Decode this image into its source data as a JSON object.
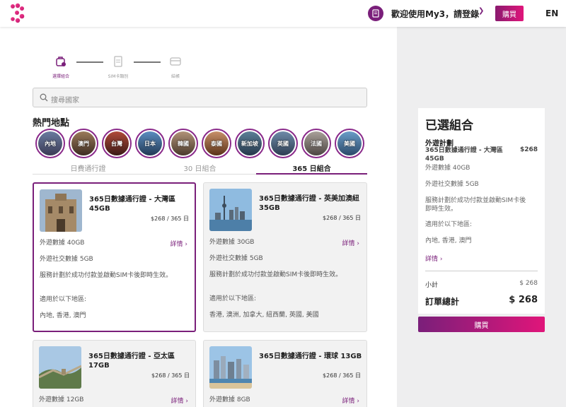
{
  "header": {
    "welcome": "歡迎使用My3，請登錄",
    "buy_label": "購買",
    "lang_label": "EN"
  },
  "stepper": [
    {
      "label": "選擇組合",
      "state": "active"
    },
    {
      "label": "SIM卡類別",
      "state": "inactive"
    },
    {
      "label": "結帳",
      "state": "inactive"
    }
  ],
  "search": {
    "placeholder": "搜尋國家"
  },
  "hot": {
    "title": "熱門地點",
    "destinations": [
      "內地",
      "澳門",
      "台灣",
      "日本",
      "韓國",
      "泰國",
      "新加坡",
      "英國",
      "法國",
      "美國"
    ]
  },
  "tabs": [
    {
      "label": "日費通行證",
      "active": false
    },
    {
      "label": "30 日組合",
      "active": false
    },
    {
      "label": "365 日組合",
      "active": true
    }
  ],
  "cards": [
    {
      "title": "365日數據通行證 - 大灣區 45GB",
      "price": "$268 / 365 日",
      "local_data": "外遊數據 40GB",
      "social_data": "外遊社交數據 5GB",
      "desc": "服務計劃於成功付款並啟動SIM卡後即時生效。",
      "regions_label": "適用於以下地區:",
      "regions": "內地, 香港, 澳門",
      "detail": "詳情",
      "selected": true
    },
    {
      "title": "365日數據通行證 - 英美加澳紐 35GB",
      "price": "$268 / 365 日",
      "local_data": "外遊數據 30GB",
      "social_data": "外遊社交數據 5GB",
      "desc": "服務計劃於成功付款並啟動SIM卡後即時生效。",
      "regions_label": "適用於以下地區:",
      "regions": "香港, 澳洲, 加拿大, 紐西蘭, 英國, 美國",
      "detail": "詳情",
      "selected": false
    },
    {
      "title": "365日數據通行證 - 亞太區 17GB",
      "price": "$268 / 365 日",
      "local_data": "外遊數據 12GB",
      "detail": "詳情",
      "selected": false
    },
    {
      "title": "365日數據通行證 - 環球 13GB",
      "price": "$268 / 365 日",
      "local_data": "外遊數據 8GB",
      "detail": "詳情",
      "selected": false
    }
  ],
  "summary": {
    "heading": "已選組合",
    "plan_heading": "外遊計劃",
    "plan_name": "365日數據通行證 - 大灣區 45GB",
    "plan_price": "$268",
    "local_data": "外遊數據 40GB",
    "social_data": "外遊社交數據 5GB",
    "desc": "服務計劃於成功付款並啟動SIM卡後即時生效。",
    "regions_label": "適用於以下地區:",
    "regions": "內地, 香港, 澳門",
    "detail": "詳情",
    "subtotal_label": "小計",
    "subtotal_value": "$ 268",
    "total_label": "訂單總計",
    "total_value": "$ 268",
    "buy_label": "購買"
  },
  "colors": {
    "brand": "#7a1f7a",
    "accent": "#e0157a"
  }
}
